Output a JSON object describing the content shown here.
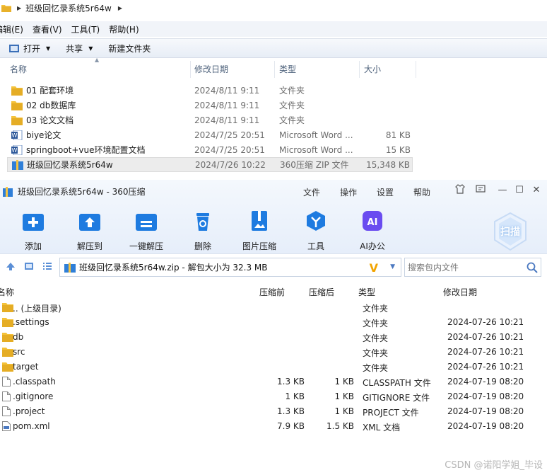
{
  "explorer": {
    "address_path": "班级回忆录系统5r64w",
    "menu": [
      "编辑(E)",
      "查看(V)",
      "工具(T)",
      "帮助(H)"
    ],
    "toolbar": {
      "open": "打开",
      "share": "共享",
      "new_folder": "新建文件夹"
    },
    "columns": {
      "name": "名称",
      "date": "修改日期",
      "type": "类型",
      "size": "大小"
    },
    "rows": [
      {
        "name": "01 配套环境",
        "date": "2024/8/11 9:11",
        "type": "文件夹",
        "size": "",
        "icon": "folder-icon"
      },
      {
        "name": "02 db数据库",
        "date": "2024/8/11 9:11",
        "type": "文件夹",
        "size": "",
        "icon": "folder-icon"
      },
      {
        "name": "03 论文文档",
        "date": "2024/8/11 9:11",
        "type": "文件夹",
        "size": "",
        "icon": "folder-icon"
      },
      {
        "name": "biye论文",
        "date": "2024/7/25 20:51",
        "type": "Microsoft Word ...",
        "size": "81 KB",
        "icon": "word-doc-icon"
      },
      {
        "name": "springboot+vue环境配置文档",
        "date": "2024/7/25 20:51",
        "type": "Microsoft Word ...",
        "size": "15 KB",
        "icon": "word-doc-icon"
      },
      {
        "name": "班级回忆录系统5r64w",
        "date": "2024/7/26 10:22",
        "type": "360压缩 ZIP 文件",
        "size": "15,348 KB",
        "icon": "zip-icon"
      }
    ]
  },
  "zip": {
    "title": "班级回忆录系统5r64w - 360压缩",
    "menu": [
      "文件",
      "操作",
      "设置",
      "帮助"
    ],
    "tools": [
      {
        "label": "添加",
        "icon": "add-icon"
      },
      {
        "label": "解压到",
        "icon": "extract-to-icon"
      },
      {
        "label": "一键解压",
        "icon": "one-click-extract-icon"
      },
      {
        "label": "删除",
        "icon": "delete-icon"
      },
      {
        "label": "图片压缩",
        "icon": "image-compress-icon"
      },
      {
        "label": "工具",
        "icon": "tools-icon"
      },
      {
        "label": "AI办公",
        "icon": "ai-office-icon"
      }
    ],
    "scan_label": "扫描",
    "path_text": "班级回忆录系统5r64w.zip - 解包大小为 32.3 MB",
    "search_placeholder": "搜索包内文件",
    "columns": {
      "name": "名称",
      "pre": "压缩前",
      "post": "压缩后",
      "type": "类型",
      "mod": "修改日期"
    },
    "rows": [
      {
        "name": ".. (上级目录)",
        "pre": "",
        "post": "",
        "type": "文件夹",
        "mod": "",
        "icon": "folder-icon"
      },
      {
        "name": ".settings",
        "pre": "",
        "post": "",
        "type": "文件夹",
        "mod": "2024-07-26 10:21",
        "icon": "folder-icon"
      },
      {
        "name": "db",
        "pre": "",
        "post": "",
        "type": "文件夹",
        "mod": "2024-07-26 10:21",
        "icon": "folder-icon"
      },
      {
        "name": "src",
        "pre": "",
        "post": "",
        "type": "文件夹",
        "mod": "2024-07-26 10:21",
        "icon": "folder-icon"
      },
      {
        "name": "target",
        "pre": "",
        "post": "",
        "type": "文件夹",
        "mod": "2024-07-26 10:21",
        "icon": "folder-icon"
      },
      {
        "name": ".classpath",
        "pre": "1.3 KB",
        "post": "1 KB",
        "type": "CLASSPATH 文件",
        "mod": "2024-07-19 08:20",
        "icon": "file-icon"
      },
      {
        "name": ".gitignore",
        "pre": "1 KB",
        "post": "1 KB",
        "type": "GITIGNORE 文件",
        "mod": "2024-07-19 08:20",
        "icon": "file-icon"
      },
      {
        "name": ".project",
        "pre": "1.3 KB",
        "post": "1 KB",
        "type": "PROJECT 文件",
        "mod": "2024-07-19 08:20",
        "icon": "file-icon"
      },
      {
        "name": "pom.xml",
        "pre": "7.9 KB",
        "post": "1.5 KB",
        "type": "XML 文档",
        "mod": "2024-07-19 08:20",
        "icon": "xml-file-icon"
      }
    ]
  },
  "watermark": "CSDN @诺阳学姐_毕设"
}
